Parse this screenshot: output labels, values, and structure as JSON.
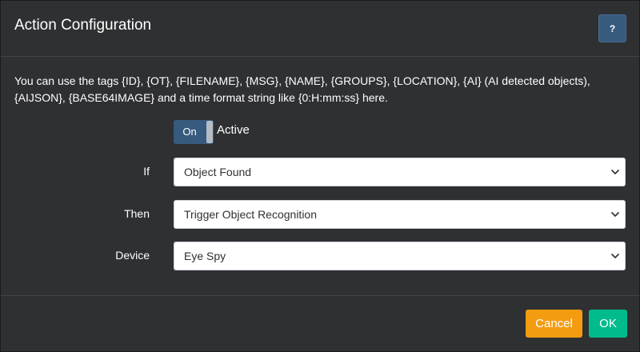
{
  "dialog": {
    "title": "Action Configuration",
    "help_label": "?"
  },
  "info": {
    "text": "You can use the tags {ID}, {OT}, {FILENAME}, {MSG}, {NAME}, {GROUPS}, {LOCATION}, {AI} (AI detected objects), {AIJSON}, {BASE64IMAGE} and a time format string like {0:H:mm:ss} here."
  },
  "toggle": {
    "state_label": "On",
    "label": "Active",
    "checked": true
  },
  "form": {
    "if_label": "If",
    "if_value": "Object Found",
    "then_label": "Then",
    "then_value": "Trigger Object Recognition",
    "device_label": "Device",
    "device_value": "Eye Spy"
  },
  "footer": {
    "cancel_label": "Cancel",
    "ok_label": "OK"
  },
  "colors": {
    "primary": "#375a7f",
    "warning": "#f39c12",
    "success": "#00bc8c",
    "background": "#2f3032"
  },
  "icons": {
    "select_arrow": "chevron-down-icon"
  }
}
